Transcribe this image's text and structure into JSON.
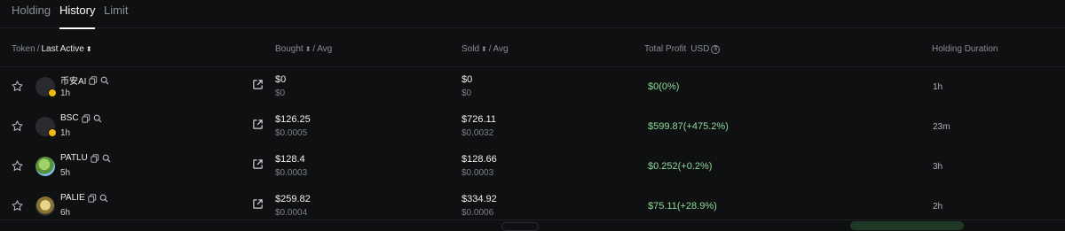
{
  "tabs": [
    {
      "label": "Holding",
      "active": false
    },
    {
      "label": "History",
      "active": true
    },
    {
      "label": "Limit",
      "active": false
    }
  ],
  "header": {
    "token": "Token",
    "sep1": "/",
    "last_active": "Last Active",
    "bought": "Bought",
    "bought_sep": "/",
    "bought_avg": "Avg",
    "sold": "Sold",
    "sold_sep": "/",
    "sold_avg": "Avg",
    "total_profit": "Total Profit",
    "currency": "USD",
    "holding_duration": "Holding Duration"
  },
  "rows": [
    {
      "name": "币安AI",
      "age": "1h",
      "bought": "$0",
      "bought_avg": "$0",
      "sold": "$0",
      "sold_avg": "$0",
      "profit": "$0(0%)",
      "duration": "1h"
    },
    {
      "name": "BSC",
      "age": "1h",
      "bought": "$126.25",
      "bought_avg": "$0.0005",
      "sold": "$726.11",
      "sold_avg": "$0.0032",
      "profit": "$599.87(+475.2%)",
      "duration": "23m"
    },
    {
      "name": "PATLU",
      "age": "5h",
      "bought": "$128.4",
      "bought_avg": "$0.0003",
      "sold": "$128.66",
      "sold_avg": "$0.0003",
      "profit": "$0.252(+0.2%)",
      "duration": "3h"
    },
    {
      "name": "PALIE",
      "age": "6h",
      "bought": "$259.82",
      "bought_avg": "$0.0004",
      "sold": "$334.92",
      "sold_avg": "$0.0006",
      "profit": "$75.11(+28.9%)",
      "duration": "2h"
    }
  ],
  "colors": {
    "profit": "#8ed99a",
    "bnb_badge": "#f0b90b"
  }
}
